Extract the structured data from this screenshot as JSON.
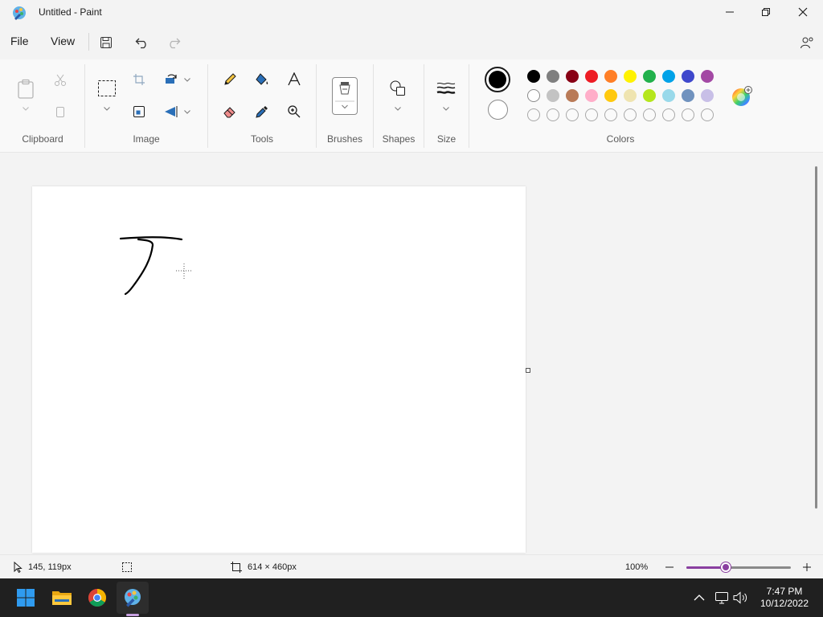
{
  "window": {
    "title": "Untitled - Paint"
  },
  "menu": {
    "file": "File",
    "view": "View"
  },
  "ribbon": {
    "clipboard_label": "Clipboard",
    "image_label": "Image",
    "tools_label": "Tools",
    "brushes_label": "Brushes",
    "shapes_label": "Shapes",
    "size_label": "Size",
    "colors_label": "Colors"
  },
  "colors": {
    "primary": "#000000",
    "secondary": "#ffffff",
    "palette_row1": [
      "#000000",
      "#7f7f7f",
      "#880015",
      "#ed1c24",
      "#ff7f27",
      "#fff200",
      "#22b14c",
      "#00a2e8",
      "#3f48cc",
      "#a349a4"
    ],
    "palette_row2": [
      "#ffffff",
      "#c3c3c3",
      "#b97a57",
      "#ffaec9",
      "#ffc90e",
      "#efe4b0",
      "#b5e61d",
      "#99d9ea",
      "#7092be",
      "#c8bfe7"
    ],
    "palette_row3_empty_count": 10,
    "accent": "#8a3fa0"
  },
  "status": {
    "cursor_position": "145, 119px",
    "canvas_size": "614 × 460px",
    "zoom": "100%",
    "zoom_fraction": 0.38
  },
  "taskbar": {
    "time": "7:47 PM",
    "date": "10/12/2022"
  }
}
